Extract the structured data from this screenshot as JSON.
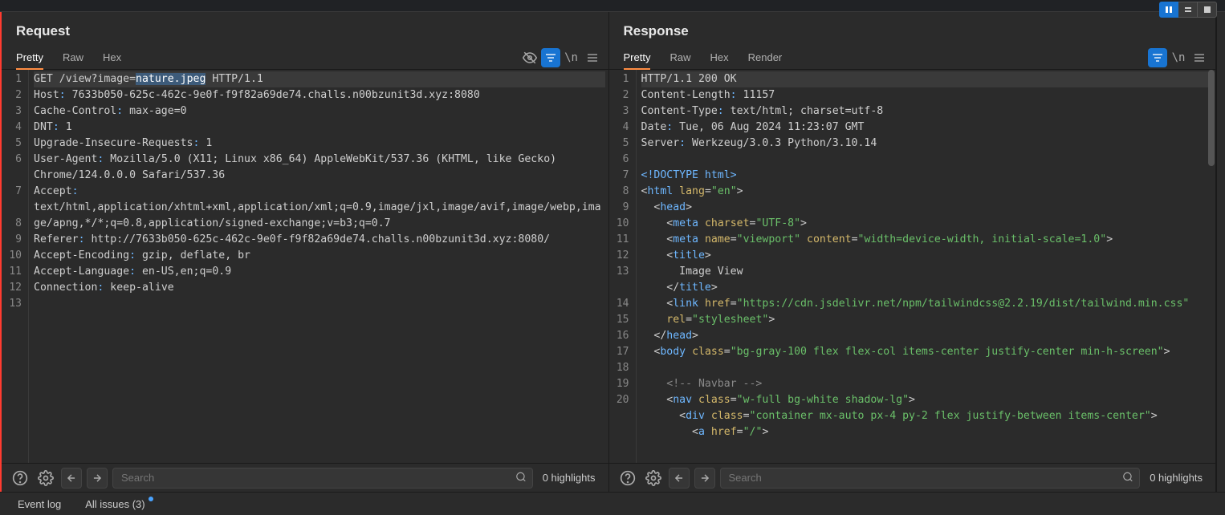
{
  "toolbar_buttons": [
    "pause",
    "equals",
    "stop"
  ],
  "footer": {
    "event_log": "Event log",
    "all_issues": "All issues (3)"
  },
  "request": {
    "title": "Request",
    "tabs": [
      "Pretty",
      "Raw",
      "Hex"
    ],
    "active_tab": "Pretty",
    "search_placeholder": "Search",
    "highlights": "0 highlights",
    "line_numbers": [
      "1",
      "2",
      "3",
      "4",
      "5",
      "6",
      "",
      "7",
      "",
      "8",
      "9",
      "10",
      "11",
      "12",
      "13"
    ],
    "lines": [
      {
        "type": "reqline",
        "method": "GET",
        "path_prefix": " /view?image=",
        "selected": "nature.jpeg",
        "path_suffix": " HTTP/1.1",
        "hl": true
      },
      {
        "type": "hdr",
        "name": "Host",
        "value": " 7633b050-625c-462c-9e0f-f9f82a69de74.challs.n00bzunit3d.xyz:8080"
      },
      {
        "type": "hdr",
        "name": "Cache-Control",
        "value": " max-age=0"
      },
      {
        "type": "hdr",
        "name": "DNT",
        "value": " 1"
      },
      {
        "type": "hdr",
        "name": "Upgrade-Insecure-Requests",
        "value": " 1"
      },
      {
        "type": "hdr",
        "name": "User-Agent",
        "value": " Mozilla/5.0 (X11; Linux x86_64) AppleWebKit/537.36 (KHTML, like Gecko) "
      },
      {
        "type": "cont",
        "value": "Chrome/124.0.0.0 Safari/537.36"
      },
      {
        "type": "hdr",
        "name": "Accept",
        "value": " "
      },
      {
        "type": "cont",
        "value": "text/html,application/xhtml+xml,application/xml;q=0.9,image/jxl,image/avif,image/webp,image/apng,*/*;q=0.8,application/signed-exchange;v=b3;q=0.7"
      },
      {
        "type": "hdr",
        "name": "Referer",
        "value": " http://7633b050-625c-462c-9e0f-f9f82a69de74.challs.n00bzunit3d.xyz:8080/"
      },
      {
        "type": "hdr",
        "name": "Accept-Encoding",
        "value": " gzip, deflate, br"
      },
      {
        "type": "hdr",
        "name": "Accept-Language",
        "value": " en-US,en;q=0.9"
      },
      {
        "type": "hdr",
        "name": "Connection",
        "value": " keep-alive"
      },
      {
        "type": "empty"
      },
      {
        "type": "empty"
      }
    ]
  },
  "response": {
    "title": "Response",
    "tabs": [
      "Pretty",
      "Raw",
      "Hex",
      "Render"
    ],
    "active_tab": "Pretty",
    "search_placeholder": "Search",
    "highlights": "0 highlights",
    "line_numbers": [
      "1",
      "2",
      "3",
      "4",
      "5",
      "6",
      "7",
      "8",
      "9",
      "10",
      "11",
      "12",
      "13",
      "",
      "14",
      "15",
      "16",
      "17",
      "18",
      "19",
      "20"
    ],
    "status_line": "HTTP/1.1 200 OK",
    "headers": [
      {
        "name": "Content-Length",
        "value": " 11157"
      },
      {
        "name": "Content-Type",
        "value": " text/html; charset=utf-8"
      },
      {
        "name": "Date",
        "value": " Tue, 06 Aug 2024 11:23:07 GMT"
      },
      {
        "name": "Server",
        "value": " Werkzeug/3.0.3 Python/3.10.14"
      }
    ],
    "html_body": {
      "doctype": "<!DOCTYPE html>",
      "html_lang": "en",
      "meta_charset": "UTF-8",
      "meta_name": "viewport",
      "meta_content": "width=device-width, initial-scale=1.0",
      "title_text": "Image View",
      "link_href": "https://cdn.jsdelivr.net/npm/tailwindcss@2.2.19/dist/tailwind.min.css",
      "link_rel": "stylesheet",
      "body_class": "bg-gray-100 flex flex-col items-center justify-center min-h-screen",
      "nav_comment": "<!-- Navbar -->",
      "nav_class": "w-full bg-white shadow-lg",
      "div_class": "container mx-auto px-4 py-2 flex justify-between items-center",
      "a_href": "/"
    }
  }
}
